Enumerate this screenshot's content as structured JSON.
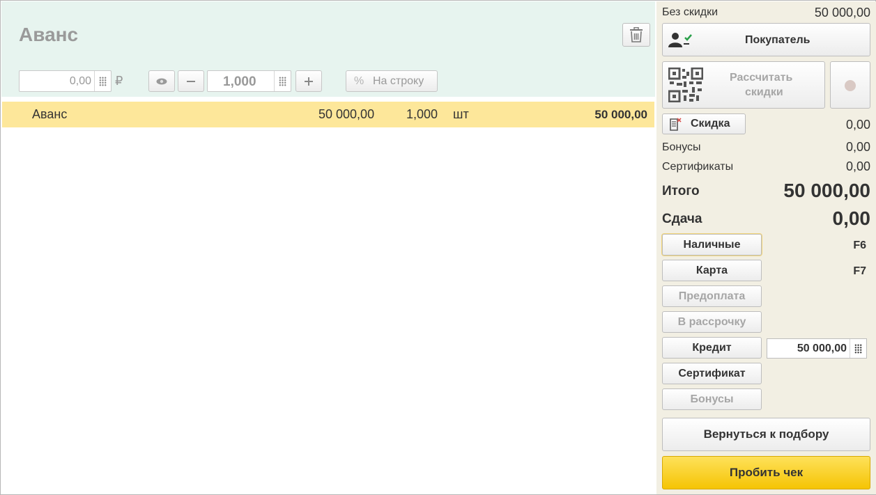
{
  "document": {
    "title": "Аванс",
    "price_value": "0,00",
    "currency_symbol": "₽",
    "quantity_value": "1,000",
    "per_line_label": "На строку",
    "percent_symbol": "%"
  },
  "items": [
    {
      "name": "Аванс",
      "price": "50 000,00",
      "qty": "1,000",
      "unit": "шт",
      "sum": "50 000,00"
    }
  ],
  "summary": {
    "no_discount_label": "Без скидки",
    "no_discount_value": "50 000,00",
    "buyer_label": "Покупатель",
    "calc_discount_label_1": "Рассчитать",
    "calc_discount_label_2": "скидки",
    "discount_label": "Скидка",
    "discount_value": "0,00",
    "bonuses_label": "Бонусы",
    "bonuses_value": "0,00",
    "certificates_label": "Сертификаты",
    "certificates_value": "0,00",
    "total_label": "Итого",
    "total_value": "50 000,00",
    "change_label": "Сдача",
    "change_value": "0,00"
  },
  "payments": {
    "cash": {
      "label": "Наличные",
      "key": "F6"
    },
    "card": {
      "label": "Карта",
      "key": "F7"
    },
    "prepay": {
      "label": "Предоплата"
    },
    "installment": {
      "label": "В рассрочку"
    },
    "credit": {
      "label": "Кредит",
      "value": "50 000,00"
    },
    "certificate": {
      "label": "Сертификат"
    },
    "bonuses": {
      "label": "Бонусы"
    }
  },
  "actions": {
    "back_label": "Вернуться к подбору",
    "print_label": "Пробить чек"
  },
  "colors": {
    "header_bg": "#e7f4ef",
    "row_highlight": "#fde79a",
    "sidebar_bg": "#f2efe3",
    "primary_button": "#f5c404",
    "check_green": "#2aa04a"
  }
}
